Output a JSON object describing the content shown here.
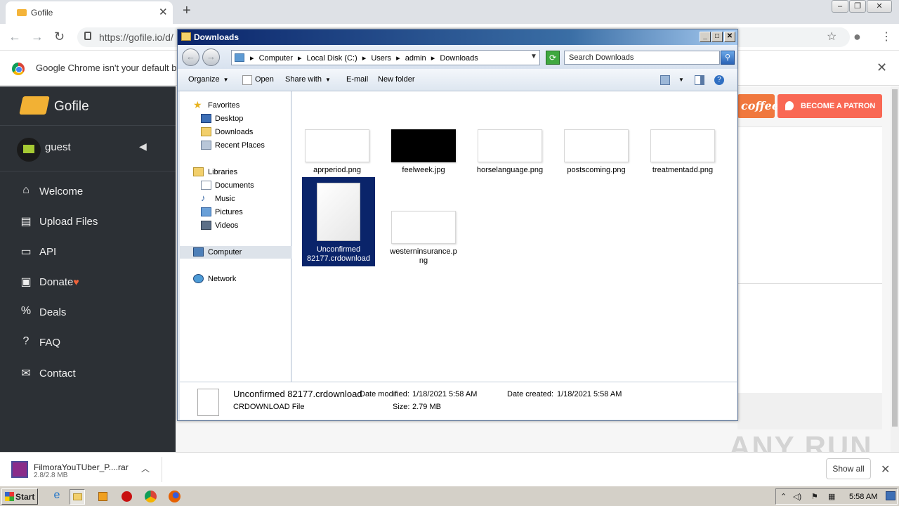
{
  "browser": {
    "tab_title": "Gofile",
    "url": "https://gofile.io/d/",
    "infobar_message": "Google Chrome isn't your default bro"
  },
  "site": {
    "brand": "Gofile",
    "user": "guest",
    "menu": [
      {
        "label": "Welcome",
        "icon": "home-icon"
      },
      {
        "label": "Upload Files",
        "icon": "file-upload-icon"
      },
      {
        "label": "API",
        "icon": "api-icon"
      },
      {
        "label": "Donate",
        "icon": "gift-icon"
      },
      {
        "label": "Deals",
        "icon": "percent-icon"
      },
      {
        "label": "FAQ",
        "icon": "question-icon"
      },
      {
        "label": "Contact",
        "icon": "envelope-icon"
      }
    ],
    "coffee_label": "coffee",
    "patron_label": "BECOME A PATRON"
  },
  "explorer": {
    "title": "Downloads",
    "breadcrumbs": [
      "Computer",
      "Local Disk (C:)",
      "Users",
      "admin",
      "Downloads"
    ],
    "search_placeholder": "Search Downloads",
    "commands": {
      "organize": "Organize",
      "open": "Open",
      "share_with": "Share with",
      "email": "E-mail",
      "new_folder": "New folder"
    },
    "nav": {
      "favorites": "Favorites",
      "desktop": "Desktop",
      "downloads": "Downloads",
      "recent": "Recent Places",
      "libraries": "Libraries",
      "documents": "Documents",
      "music": "Music",
      "pictures": "Pictures",
      "videos": "Videos",
      "computer": "Computer",
      "network": "Network"
    },
    "files": [
      {
        "name": "aprperiod.png"
      },
      {
        "name": "feelweek.jpg"
      },
      {
        "name": "horselanguage.png"
      },
      {
        "name": "postscoming.png"
      },
      {
        "name": "treatmentadd.png"
      },
      {
        "name_line1": "Unconfirmed",
        "name_line2": "82177.crdownload"
      },
      {
        "name_line1": "westerninsurance.p",
        "name_line2": "ng"
      }
    ],
    "details": {
      "filename": "Unconfirmed 82177.crdownload",
      "type": "CRDOWNLOAD File",
      "modified_label": "Date modified:",
      "modified_value": "1/18/2021 5:58 AM",
      "size_label": "Size:",
      "size_value": "2.79 MB",
      "created_label": "Date created:",
      "created_value": "1/18/2021 5:58 AM"
    }
  },
  "download_shelf": {
    "filename": "FilmoraYouTUber_P....rar",
    "progress": "2.8/2.8 MB",
    "show_all": "Show all"
  },
  "taskbar": {
    "start": "Start",
    "clock": "5:58 AM"
  },
  "watermark": "ANY RUN"
}
